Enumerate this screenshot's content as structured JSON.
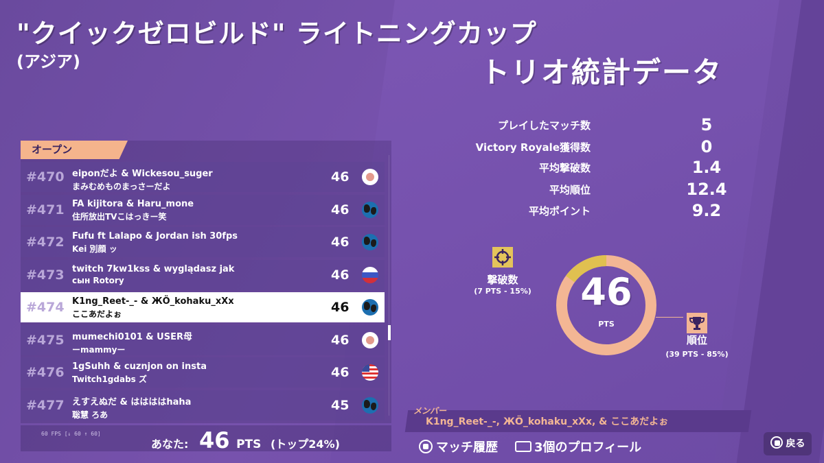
{
  "header": {
    "title": "\"クイックゼロビルド\" ライトニングカップ",
    "region": "(アジア)"
  },
  "leaderboard": {
    "tab_label": "オープン",
    "rows": [
      {
        "rank": "#470",
        "name1": "eiponだよ & Wickesou_suger",
        "name2": "まみむめものまっさーだよ",
        "points": "46",
        "flag": "jp"
      },
      {
        "rank": "#471",
        "name1": "FA kijitora & Haru_mone",
        "name2": "住所放出TVこはっきー笑",
        "points": "46",
        "flag": "globe"
      },
      {
        "rank": "#472",
        "name1": "Fufu ft Lalapo & Jordan ish 30fps",
        "name2": "Kei 別顔 ッ",
        "points": "46",
        "flag": "globe"
      },
      {
        "rank": "#473",
        "name1": "twitch 7kw1kss & wyglądasz jak",
        "name2": "сын Rotory",
        "points": "46",
        "flag": "ru"
      },
      {
        "rank": "#474",
        "name1": "K1ng_Reet-_- & ЖÖ_kohaku_xXx",
        "name2": "ここあだよぉ",
        "points": "46",
        "flag": "globe",
        "selected": true
      },
      {
        "rank": "#475",
        "name1": "mumechi0101 & USER母",
        "name2": "ーmammyー",
        "points": "46",
        "flag": "jp"
      },
      {
        "rank": "#476",
        "name1": "1gSuhh & cuznjon on insta",
        "name2": "Twitch1gdabs ズ",
        "points": "46",
        "flag": "us"
      },
      {
        "rank": "#477",
        "name1": "えすえぬだ & ははははhaha",
        "name2": "聡慧 ろあ",
        "points": "45",
        "flag": "globe"
      }
    ]
  },
  "footer": {
    "fps": "60 FPS [↓ 60 ↑ 60]",
    "you_label": "あなた:",
    "you_points": "46",
    "pts_label": "PTS",
    "top_percent": "(トップ24%)"
  },
  "stats": {
    "title": "トリオ統計データ",
    "items": [
      {
        "label": "プレイしたマッチ数",
        "value": "5"
      },
      {
        "label": "Victory Royale獲得数",
        "value": "0"
      },
      {
        "label": "平均撃破数",
        "value": "1.4"
      },
      {
        "label": "平均順位",
        "value": "12.4"
      },
      {
        "label": "平均ポイント",
        "value": "9.2"
      }
    ]
  },
  "donut": {
    "total": "46",
    "unit": "PTS",
    "eliminations_share": 0.15,
    "placement_share": 0.85,
    "colors": {
      "eliminations": "#e0c050",
      "placement": "#f3b694"
    },
    "elim_label": "撃破数",
    "elim_sub": "(7 PTS - 15%)",
    "elim_icon": "crosshair-icon",
    "place_label": "順位",
    "place_sub": "(39 PTS - 85%)",
    "place_icon": "trophy-icon"
  },
  "members": {
    "tag": "メンバー",
    "text": "K1ng_Reet-_-, ЖÖ_kohaku_xXx, & ここあだよぉ"
  },
  "bottom_bar": {
    "match_history": "マッチ履歴",
    "profiles": "3個のプロフィール",
    "back": "戻る"
  }
}
